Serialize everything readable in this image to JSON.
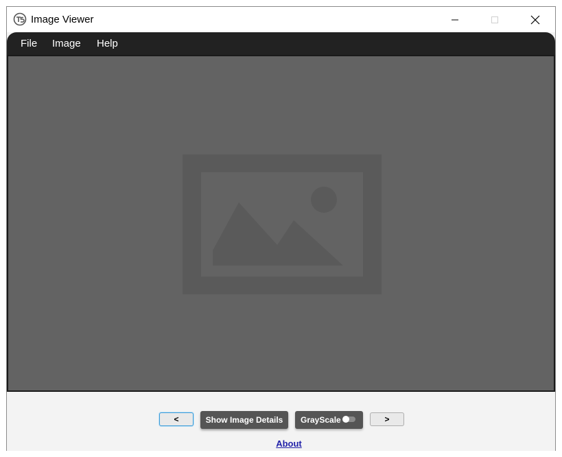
{
  "window": {
    "title": "Image Viewer",
    "app_icon": "app-logo-icon",
    "controls": [
      "minimize-icon",
      "maximize-icon",
      "close-icon"
    ]
  },
  "menubar": {
    "items": [
      {
        "label": "File"
      },
      {
        "label": "Image"
      },
      {
        "label": "Help"
      }
    ]
  },
  "viewer": {
    "placeholder_icon": "image-placeholder-icon"
  },
  "controls": {
    "prev_label": "<",
    "details_label": "Show Image Details",
    "grayscale_label": "GrayScale",
    "grayscale_on": false,
    "next_label": ">",
    "about_label": "About"
  },
  "colors": {
    "menubar_bg": "#222222",
    "viewport_bg": "#636363",
    "button_dark": "#555555",
    "link": "#1f1fa8",
    "focus_ring": "#3c9cd8"
  }
}
